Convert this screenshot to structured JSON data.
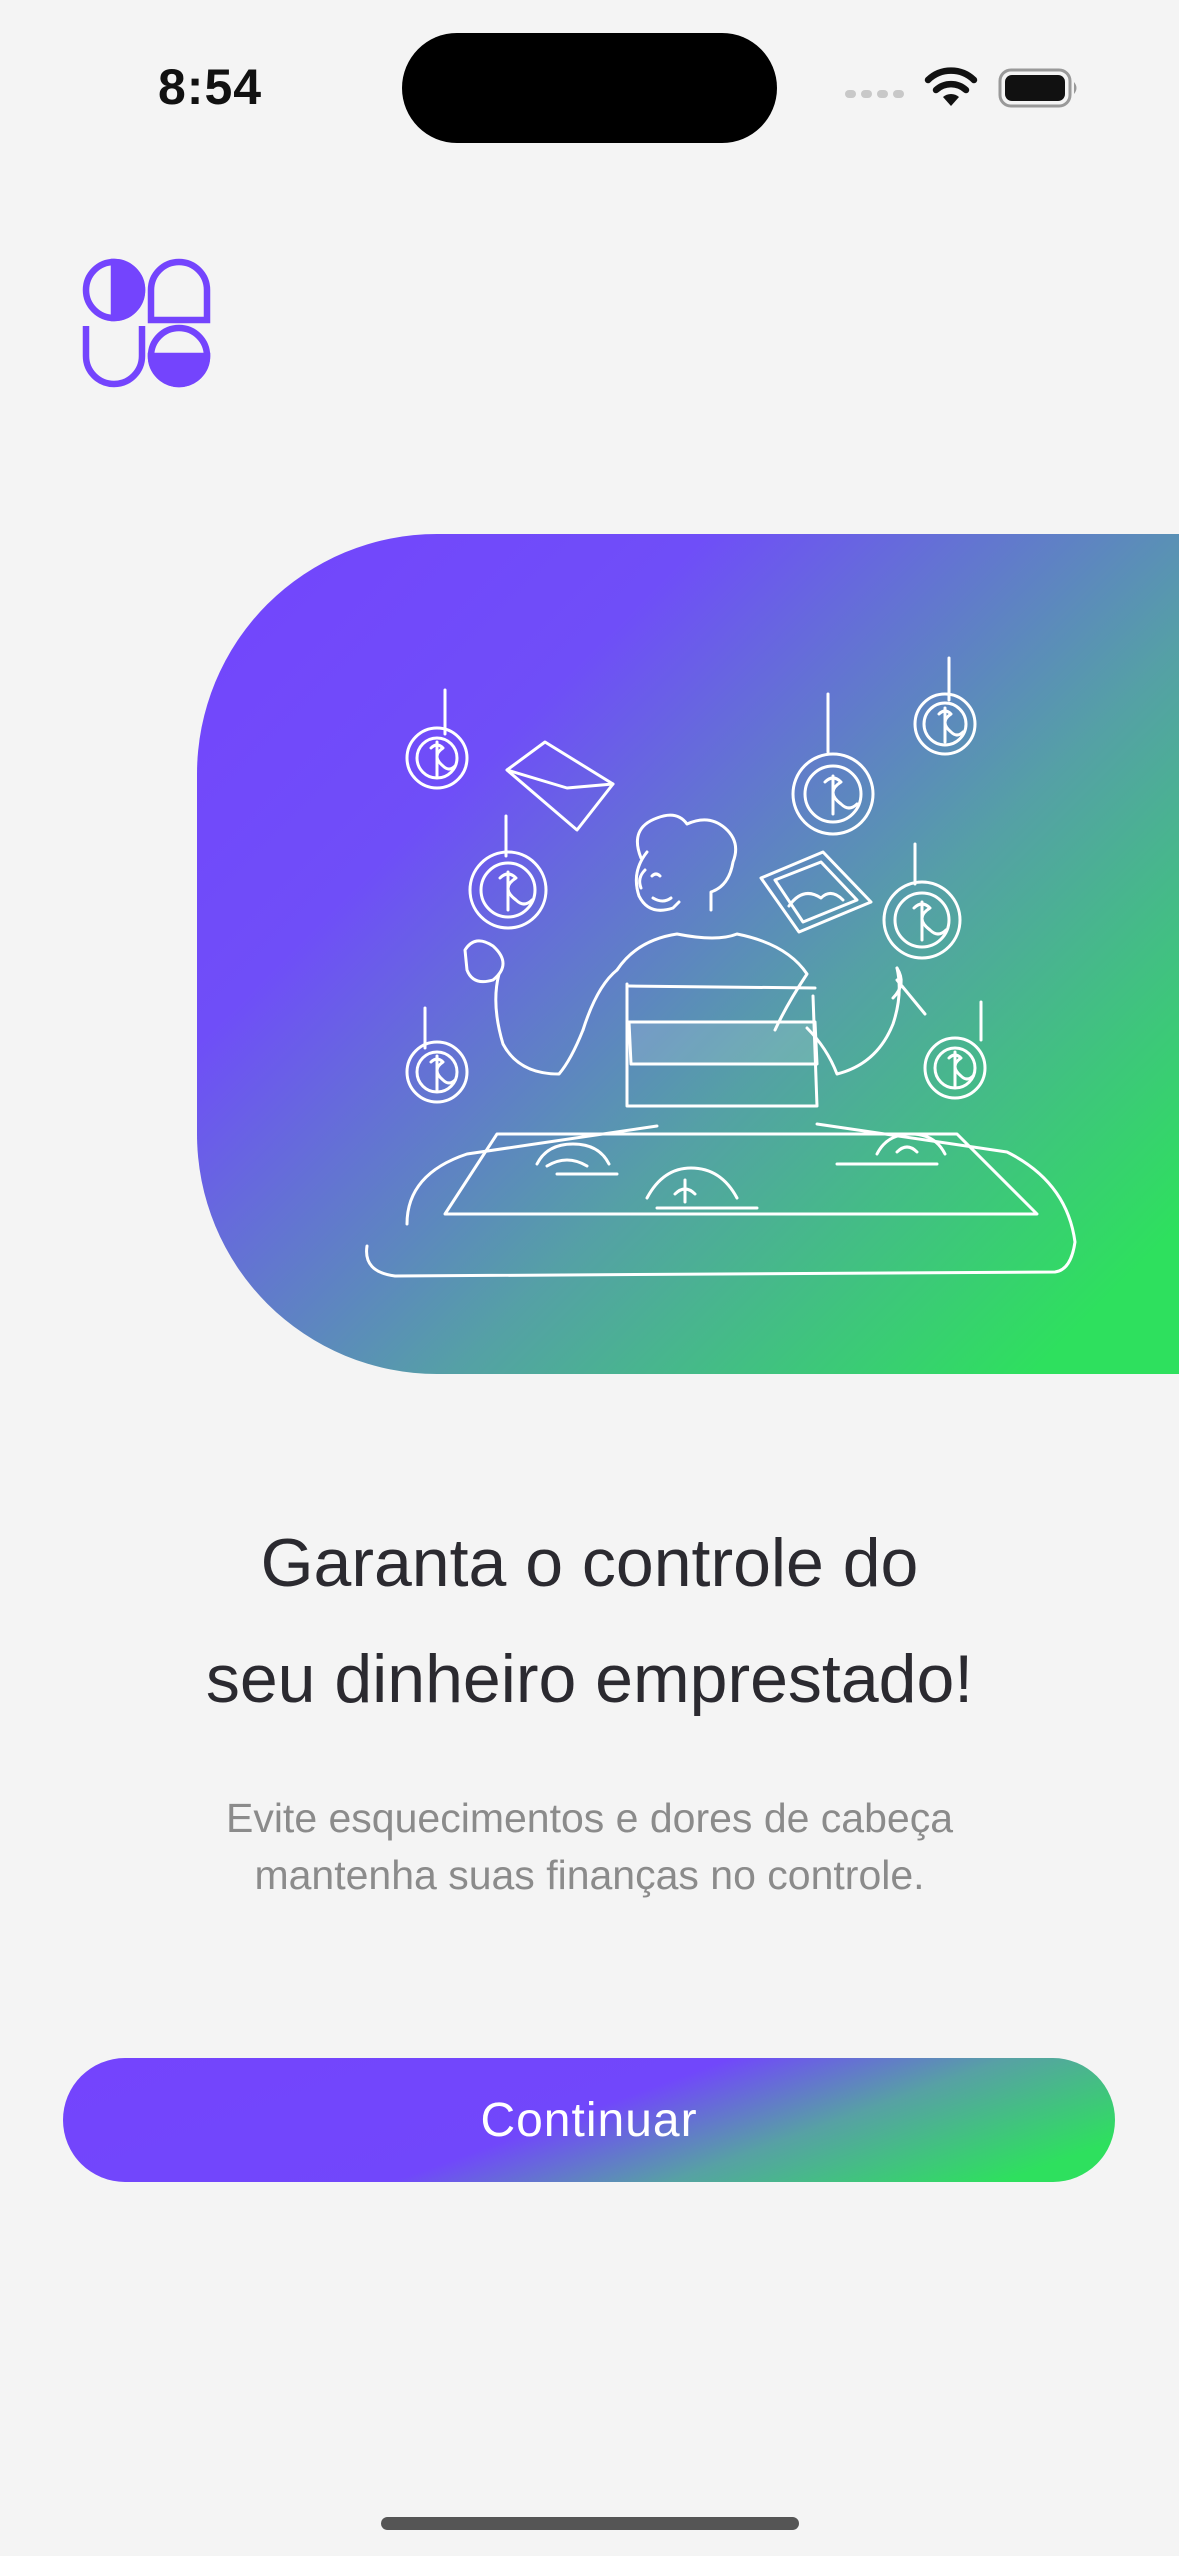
{
  "status_bar": {
    "time": "8:54",
    "icons": [
      "signal-icon",
      "wifi-icon",
      "battery-icon"
    ]
  },
  "logo": {
    "icon": "app-logo-icon",
    "color": "#7444FD"
  },
  "hero": {
    "illustration": "person-in-money-pool-illustration",
    "gradient_colors": [
      "#7444FD",
      "#2EE05E"
    ]
  },
  "onboarding": {
    "title_line1": "Garanta o controle do",
    "title_line2": "seu dinheiro emprestado!",
    "subtitle_line1": "Evite esquecimentos e dores de cabeça",
    "subtitle_line2": "mantenha suas finanças no controle.",
    "continue_label": "Continuar"
  },
  "colors": {
    "accent_purple": "#7444FD",
    "accent_green": "#2EE05E",
    "title_text": "#2B2A30",
    "subtitle_text": "#8B8B8B",
    "background": "#F4F4F4"
  }
}
